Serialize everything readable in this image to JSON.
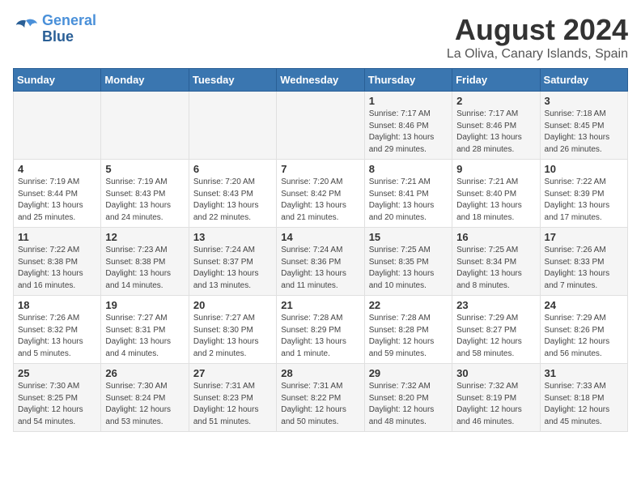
{
  "logo": {
    "line1": "General",
    "line2": "Blue"
  },
  "title": "August 2024",
  "subtitle": "La Oliva, Canary Islands, Spain",
  "days_of_week": [
    "Sunday",
    "Monday",
    "Tuesday",
    "Wednesday",
    "Thursday",
    "Friday",
    "Saturday"
  ],
  "weeks": [
    [
      {
        "day": "",
        "content": ""
      },
      {
        "day": "",
        "content": ""
      },
      {
        "day": "",
        "content": ""
      },
      {
        "day": "",
        "content": ""
      },
      {
        "day": "1",
        "content": "Sunrise: 7:17 AM\nSunset: 8:46 PM\nDaylight: 13 hours\nand 29 minutes."
      },
      {
        "day": "2",
        "content": "Sunrise: 7:17 AM\nSunset: 8:46 PM\nDaylight: 13 hours\nand 28 minutes."
      },
      {
        "day": "3",
        "content": "Sunrise: 7:18 AM\nSunset: 8:45 PM\nDaylight: 13 hours\nand 26 minutes."
      }
    ],
    [
      {
        "day": "4",
        "content": "Sunrise: 7:19 AM\nSunset: 8:44 PM\nDaylight: 13 hours\nand 25 minutes."
      },
      {
        "day": "5",
        "content": "Sunrise: 7:19 AM\nSunset: 8:43 PM\nDaylight: 13 hours\nand 24 minutes."
      },
      {
        "day": "6",
        "content": "Sunrise: 7:20 AM\nSunset: 8:43 PM\nDaylight: 13 hours\nand 22 minutes."
      },
      {
        "day": "7",
        "content": "Sunrise: 7:20 AM\nSunset: 8:42 PM\nDaylight: 13 hours\nand 21 minutes."
      },
      {
        "day": "8",
        "content": "Sunrise: 7:21 AM\nSunset: 8:41 PM\nDaylight: 13 hours\nand 20 minutes."
      },
      {
        "day": "9",
        "content": "Sunrise: 7:21 AM\nSunset: 8:40 PM\nDaylight: 13 hours\nand 18 minutes."
      },
      {
        "day": "10",
        "content": "Sunrise: 7:22 AM\nSunset: 8:39 PM\nDaylight: 13 hours\nand 17 minutes."
      }
    ],
    [
      {
        "day": "11",
        "content": "Sunrise: 7:22 AM\nSunset: 8:38 PM\nDaylight: 13 hours\nand 16 minutes."
      },
      {
        "day": "12",
        "content": "Sunrise: 7:23 AM\nSunset: 8:38 PM\nDaylight: 13 hours\nand 14 minutes."
      },
      {
        "day": "13",
        "content": "Sunrise: 7:24 AM\nSunset: 8:37 PM\nDaylight: 13 hours\nand 13 minutes."
      },
      {
        "day": "14",
        "content": "Sunrise: 7:24 AM\nSunset: 8:36 PM\nDaylight: 13 hours\nand 11 minutes."
      },
      {
        "day": "15",
        "content": "Sunrise: 7:25 AM\nSunset: 8:35 PM\nDaylight: 13 hours\nand 10 minutes."
      },
      {
        "day": "16",
        "content": "Sunrise: 7:25 AM\nSunset: 8:34 PM\nDaylight: 13 hours\nand 8 minutes."
      },
      {
        "day": "17",
        "content": "Sunrise: 7:26 AM\nSunset: 8:33 PM\nDaylight: 13 hours\nand 7 minutes."
      }
    ],
    [
      {
        "day": "18",
        "content": "Sunrise: 7:26 AM\nSunset: 8:32 PM\nDaylight: 13 hours\nand 5 minutes."
      },
      {
        "day": "19",
        "content": "Sunrise: 7:27 AM\nSunset: 8:31 PM\nDaylight: 13 hours\nand 4 minutes."
      },
      {
        "day": "20",
        "content": "Sunrise: 7:27 AM\nSunset: 8:30 PM\nDaylight: 13 hours\nand 2 minutes."
      },
      {
        "day": "21",
        "content": "Sunrise: 7:28 AM\nSunset: 8:29 PM\nDaylight: 13 hours\nand 1 minute."
      },
      {
        "day": "22",
        "content": "Sunrise: 7:28 AM\nSunset: 8:28 PM\nDaylight: 12 hours\nand 59 minutes."
      },
      {
        "day": "23",
        "content": "Sunrise: 7:29 AM\nSunset: 8:27 PM\nDaylight: 12 hours\nand 58 minutes."
      },
      {
        "day": "24",
        "content": "Sunrise: 7:29 AM\nSunset: 8:26 PM\nDaylight: 12 hours\nand 56 minutes."
      }
    ],
    [
      {
        "day": "25",
        "content": "Sunrise: 7:30 AM\nSunset: 8:25 PM\nDaylight: 12 hours\nand 54 minutes."
      },
      {
        "day": "26",
        "content": "Sunrise: 7:30 AM\nSunset: 8:24 PM\nDaylight: 12 hours\nand 53 minutes."
      },
      {
        "day": "27",
        "content": "Sunrise: 7:31 AM\nSunset: 8:23 PM\nDaylight: 12 hours\nand 51 minutes."
      },
      {
        "day": "28",
        "content": "Sunrise: 7:31 AM\nSunset: 8:22 PM\nDaylight: 12 hours\nand 50 minutes."
      },
      {
        "day": "29",
        "content": "Sunrise: 7:32 AM\nSunset: 8:20 PM\nDaylight: 12 hours\nand 48 minutes."
      },
      {
        "day": "30",
        "content": "Sunrise: 7:32 AM\nSunset: 8:19 PM\nDaylight: 12 hours\nand 46 minutes."
      },
      {
        "day": "31",
        "content": "Sunrise: 7:33 AM\nSunset: 8:18 PM\nDaylight: 12 hours\nand 45 minutes."
      }
    ]
  ]
}
